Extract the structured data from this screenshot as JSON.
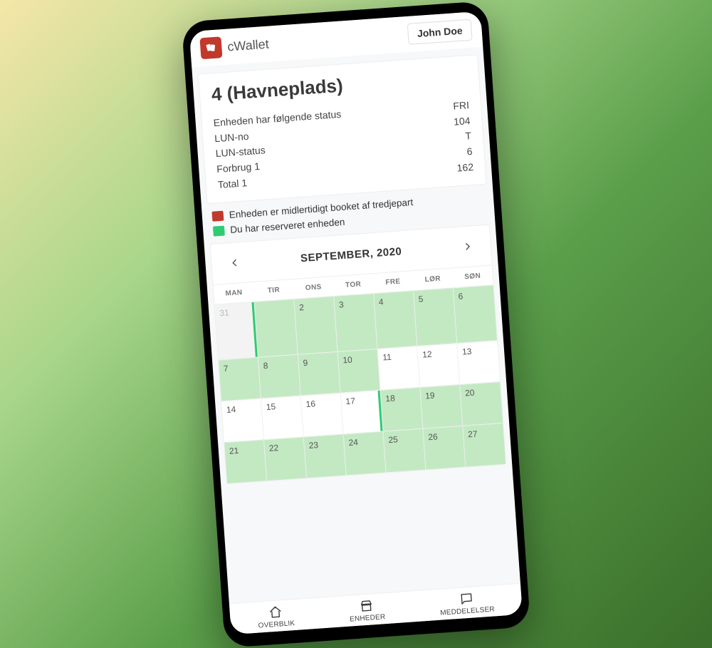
{
  "header": {
    "app_name": "cWallet",
    "user_name": "John Doe"
  },
  "page": {
    "title": "4 (Havneplads)",
    "status_rows": [
      {
        "label": "Enheden har følgende status",
        "value": "FRI"
      },
      {
        "label": "LUN-no",
        "value": "104"
      },
      {
        "label": "LUN-status",
        "value": "T"
      },
      {
        "label": "Forbrug 1",
        "value": "6"
      },
      {
        "label": "Total 1",
        "value": "162"
      }
    ]
  },
  "legend": {
    "booked": "Enheden er midlertidigt booket af tredjepart",
    "reserved": "Du har reserveret enheden"
  },
  "calendar": {
    "title": "SEPTEMBER, 2020",
    "dow": [
      "MAN",
      "TIR",
      "ONS",
      "TOR",
      "FRE",
      "LØR",
      "SØN"
    ],
    "weeks": [
      [
        {
          "n": "31",
          "prev": true,
          "bar_right": true
        },
        {
          "n": "",
          "res": true
        },
        {
          "n": "2",
          "res": true
        },
        {
          "n": "3",
          "res": true
        },
        {
          "n": "4",
          "res": true
        },
        {
          "n": "5",
          "res": true
        },
        {
          "n": "6",
          "res": true
        }
      ],
      [
        {
          "n": "7",
          "res": true
        },
        {
          "n": "8",
          "res": true
        },
        {
          "n": "9",
          "res": true
        },
        {
          "n": "10",
          "res": true
        },
        {
          "n": "11"
        },
        {
          "n": "12"
        },
        {
          "n": "13"
        }
      ],
      [
        {
          "n": "14"
        },
        {
          "n": "15"
        },
        {
          "n": "16"
        },
        {
          "n": "17",
          "bar_right": true
        },
        {
          "n": "18",
          "res": true
        },
        {
          "n": "19",
          "res": true
        },
        {
          "n": "20",
          "res": true
        }
      ],
      [
        {
          "n": "21",
          "res": true
        },
        {
          "n": "22",
          "res": true
        },
        {
          "n": "23",
          "res": true
        },
        {
          "n": "24",
          "res": true
        },
        {
          "n": "25",
          "res": true
        },
        {
          "n": "26",
          "res": true
        },
        {
          "n": "27",
          "res": true
        }
      ]
    ]
  },
  "nav": {
    "overview": "OVERBLIK",
    "units": "ENHEDER",
    "messages": "MEDDELELSER"
  }
}
